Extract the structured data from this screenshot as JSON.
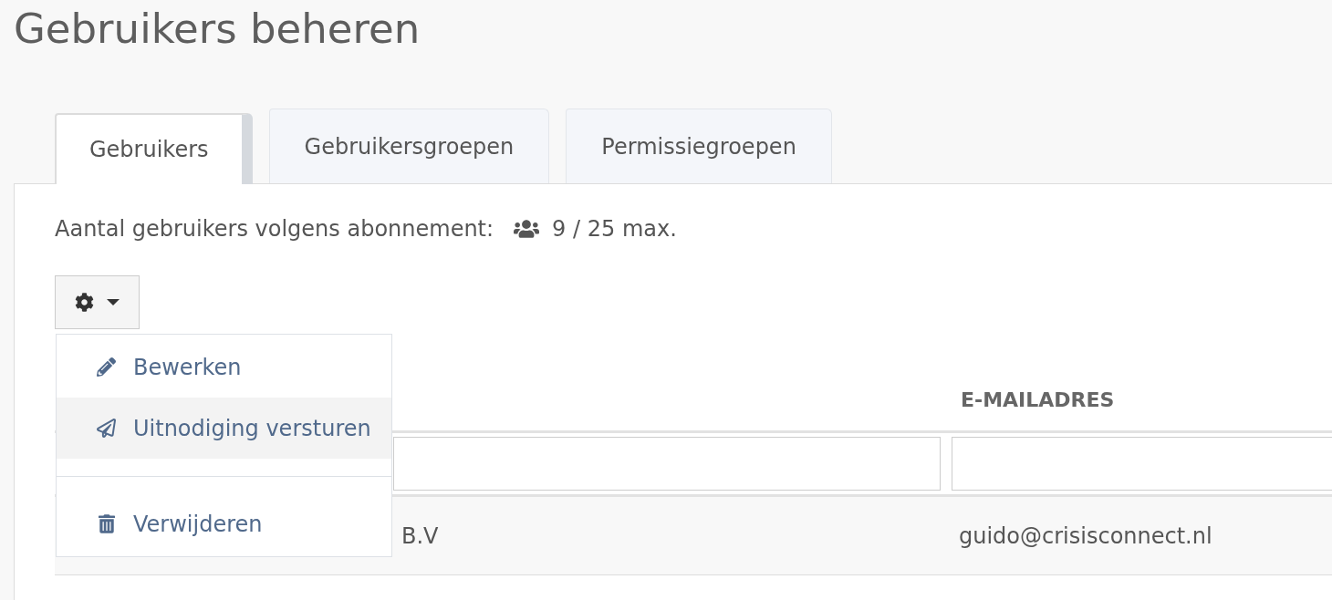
{
  "page": {
    "title": "Gebruikers beheren"
  },
  "tabs": [
    {
      "label": "Gebruikers",
      "selected": true
    },
    {
      "label": "Gebruikersgroepen",
      "selected": false
    },
    {
      "label": "Permissiegroepen",
      "selected": false
    }
  ],
  "subscription": {
    "label": "Aantal gebruikers volgens abonnement:",
    "count": "9 / 25 max."
  },
  "actions_menu": {
    "expanded": true,
    "sections": [
      {
        "items": [
          {
            "label": "Bewerken",
            "highlighted": false
          },
          {
            "label": "Uitnodiging versturen",
            "highlighted": true
          }
        ]
      },
      {
        "items": [
          {
            "label": "Verwijderen",
            "highlighted": false
          }
        ]
      }
    ]
  },
  "table": {
    "columns": [
      {
        "kind": "covered"
      },
      {
        "kind": "text",
        "heading": "E-MAILADRES"
      }
    ],
    "rows": [
      {
        "cells": [
          "B.V",
          "guido@crisisconnect.nl"
        ]
      }
    ]
  }
}
